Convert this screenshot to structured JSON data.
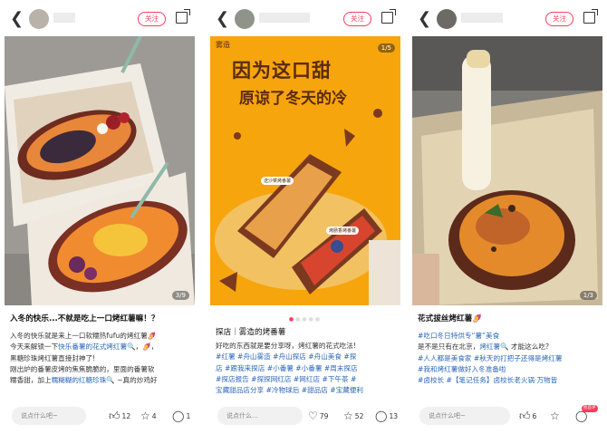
{
  "panels": [
    {
      "follow_label": "关注",
      "photo_counter": "3/9",
      "title": "入冬的快乐...不就是吃上一口烤红薯嘛！？",
      "body": [
        [
          {
            "t": "入冬的快乐就是来上一口软糯热fufu的烤红薯🍠"
          }
        ],
        [
          {
            "t": "今天来解锁一下"
          },
          {
            "t": "快乐番薯的花式烤红薯",
            "link": true
          },
          {
            "t": "🔍，🍠，"
          }
        ],
        [
          {
            "t": "黑糖珍珠烤红薯直接封神了!"
          }
        ],
        [
          {
            "t": "刚出炉的番薯皮烤的焦焦脆脆的，里面的番薯软"
          }
        ],
        [
          {
            "t": "糯香甜，加上"
          },
          {
            "t": "糯糊糊的红糖珍珠",
            "link": true
          },
          {
            "t": "🔍 ~真的炒鸡好"
          }
        ]
      ],
      "comment_placeholder": "说点什么吧~",
      "likes": "12",
      "stars": "4",
      "comments": "1"
    },
    {
      "follow_label": "关注",
      "photo_counter": "1/5",
      "poster": {
        "brand": "雾造",
        "headline1": "因为这口甜",
        "headline2": "原谅了冬天的冷",
        "tag1": "送沙菜烤番薯",
        "tag2": "烤肠香烤番薯"
      },
      "title": "探店｜雾造的烤番薯",
      "body": [
        [
          {
            "t": "好吃的东西就是要分享呀，烤红薯的花式吃法!"
          }
        ],
        [
          {
            "t": "#红薯 #舟山雾造 #舟山探店 #舟山美食 #探",
            "link": true
          }
        ],
        [
          {
            "t": "店 #跟我来探店 #小番薯 #小番薯 #周末探店",
            "link": true
          }
        ],
        [
          {
            "t": "#探店报告 #探探网红店 #网红店 #下午茶 #",
            "link": true
          }
        ],
        [
          {
            "t": "宝藏甜品店分享 #冷物球后 #甜品店 #宝藏便利",
            "link": true
          }
        ]
      ],
      "comment_placeholder": "说点什么...",
      "likes": "79",
      "stars": "52",
      "comments": "13"
    },
    {
      "follow_label": "关注",
      "photo_counter": "1/3",
      "title": "花式拔丝烤红薯🍠",
      "body": [
        [
          {
            "t": "#吃口冬日特供专“薯”美食",
            "link": true
          }
        ],
        [
          {
            "t": "是不是只有在北京，"
          },
          {
            "t": "烤红薯",
            "link": true
          },
          {
            "t": "🔍 才能这么吃?"
          }
        ],
        [
          {
            "t": "#人人都是美食家 #秋天的打把子还得是烤红薯",
            "link": true
          }
        ],
        [
          {
            "t": "#我和烤红薯做好入冬准备啦",
            "link": true
          }
        ],
        [
          {
            "t": "#卤校长 #【笔记任务】卤校长老火锅·万物皆",
            "link": true
          }
        ]
      ],
      "comment_placeholder": "说点什么吧~",
      "likes": "6",
      "comments_badge": "抢首评"
    }
  ]
}
